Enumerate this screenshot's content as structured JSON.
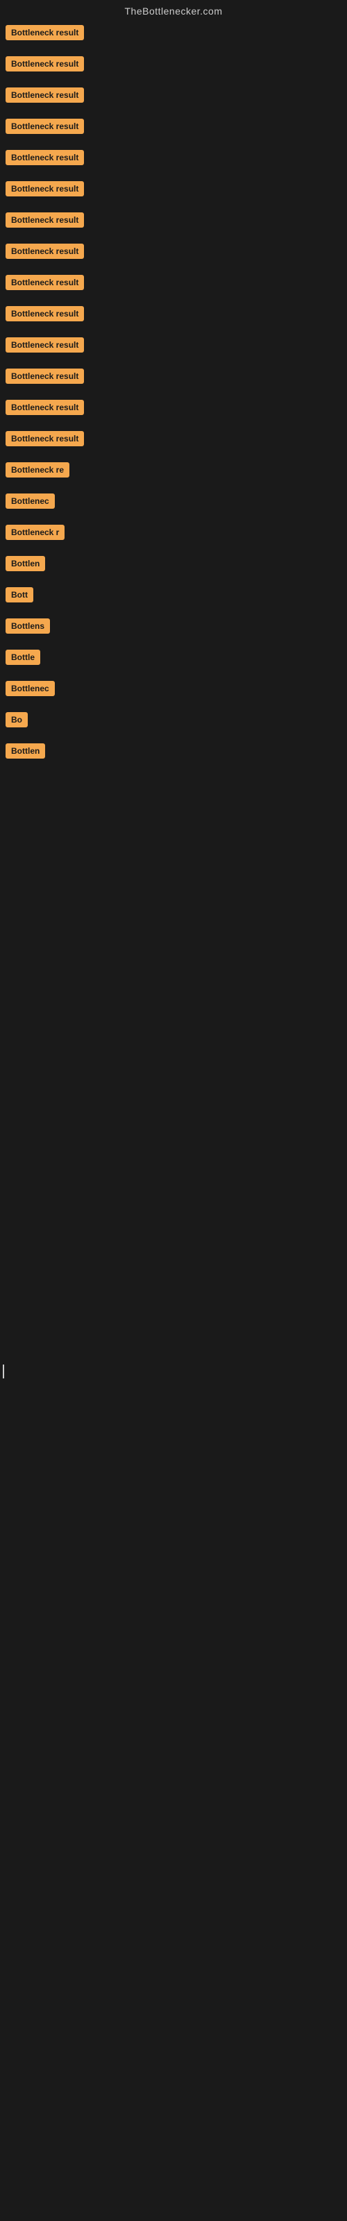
{
  "site": {
    "title": "TheBottlenecker.com"
  },
  "items": [
    {
      "id": 1,
      "label": "Bottleneck result"
    },
    {
      "id": 2,
      "label": "Bottleneck result"
    },
    {
      "id": 3,
      "label": "Bottleneck result"
    },
    {
      "id": 4,
      "label": "Bottleneck result"
    },
    {
      "id": 5,
      "label": "Bottleneck result"
    },
    {
      "id": 6,
      "label": "Bottleneck result"
    },
    {
      "id": 7,
      "label": "Bottleneck result"
    },
    {
      "id": 8,
      "label": "Bottleneck result"
    },
    {
      "id": 9,
      "label": "Bottleneck result"
    },
    {
      "id": 10,
      "label": "Bottleneck result"
    },
    {
      "id": 11,
      "label": "Bottleneck result"
    },
    {
      "id": 12,
      "label": "Bottleneck result"
    },
    {
      "id": 13,
      "label": "Bottleneck result"
    },
    {
      "id": 14,
      "label": "Bottleneck result"
    },
    {
      "id": 15,
      "label": "Bottleneck re"
    },
    {
      "id": 16,
      "label": "Bottlenec"
    },
    {
      "id": 17,
      "label": "Bottleneck r"
    },
    {
      "id": 18,
      "label": "Bottlen"
    },
    {
      "id": 19,
      "label": "Bott"
    },
    {
      "id": 20,
      "label": "Bottlens"
    },
    {
      "id": 21,
      "label": "Bottle"
    },
    {
      "id": 22,
      "label": "Bottlenec"
    },
    {
      "id": 23,
      "label": "Bo"
    },
    {
      "id": 24,
      "label": "Bottlen"
    }
  ]
}
